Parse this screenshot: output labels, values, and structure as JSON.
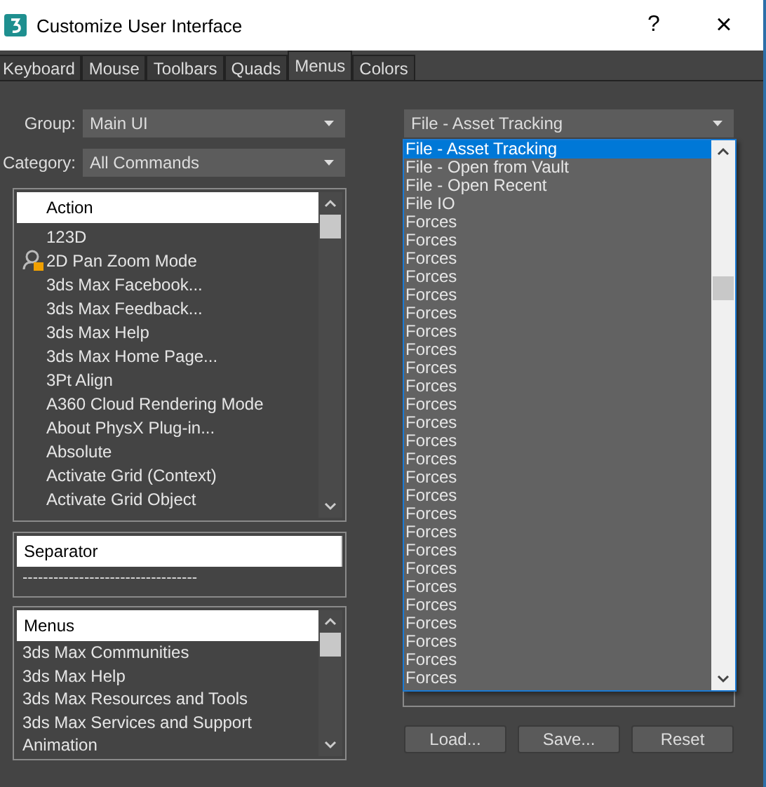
{
  "window": {
    "title": "Customize User Interface",
    "help": "?",
    "close": "×"
  },
  "tabs": [
    {
      "label": "Keyboard",
      "selected": false
    },
    {
      "label": "Mouse",
      "selected": false
    },
    {
      "label": "Toolbars",
      "selected": false
    },
    {
      "label": "Quads",
      "selected": false
    },
    {
      "label": "Menus",
      "selected": true
    },
    {
      "label": "Colors",
      "selected": false
    }
  ],
  "group": {
    "label": "Group:",
    "value": "Main UI"
  },
  "category": {
    "label": "Category:",
    "value": "All Commands"
  },
  "action_list": {
    "header": "Action",
    "items": [
      {
        "label": "123D",
        "kind": "plain"
      },
      {
        "label": "2D Pan Zoom Mode",
        "kind": "locked"
      },
      {
        "label": "3ds Max Facebook...",
        "kind": "plain"
      },
      {
        "label": "3ds Max Feedback...",
        "kind": "plain"
      },
      {
        "label": "3ds Max Help",
        "kind": "plain"
      },
      {
        "label": "3ds Max Home Page...",
        "kind": "plain"
      },
      {
        "label": "3Pt Align",
        "kind": "plain"
      },
      {
        "label": "A360 Cloud Rendering Mode",
        "kind": "plain"
      },
      {
        "label": "About PhysX Plug-in...",
        "kind": "plain"
      },
      {
        "label": "Absolute",
        "kind": "plain"
      },
      {
        "label": "Activate Grid (Context)",
        "kind": "plain"
      },
      {
        "label": "Activate Grid Object",
        "kind": "plain"
      }
    ]
  },
  "separator_list": {
    "header": "Separator",
    "items": [
      "----------------------------------"
    ]
  },
  "menus_list": {
    "header": "Menus",
    "items": [
      "3ds Max Communities",
      "3ds Max Help",
      "3ds Max Resources and Tools",
      "3ds Max Services and Support",
      "Animation"
    ]
  },
  "menu_dropdown": {
    "value": "File - Asset Tracking",
    "options": [
      {
        "label": "File - Asset Tracking",
        "selected": true
      },
      {
        "label": "File - Open from Vault",
        "selected": false
      },
      {
        "label": "File - Open Recent",
        "selected": false
      },
      {
        "label": "File IO",
        "selected": false
      },
      {
        "label": "Forces",
        "selected": false
      },
      {
        "label": "Forces",
        "selected": false
      },
      {
        "label": "Forces",
        "selected": false
      },
      {
        "label": "Forces",
        "selected": false
      },
      {
        "label": "Forces",
        "selected": false
      },
      {
        "label": "Forces",
        "selected": false
      },
      {
        "label": "Forces",
        "selected": false
      },
      {
        "label": "Forces",
        "selected": false
      },
      {
        "label": "Forces",
        "selected": false
      },
      {
        "label": "Forces",
        "selected": false
      },
      {
        "label": "Forces",
        "selected": false
      },
      {
        "label": "Forces",
        "selected": false
      },
      {
        "label": "Forces",
        "selected": false
      },
      {
        "label": "Forces",
        "selected": false
      },
      {
        "label": "Forces",
        "selected": false
      },
      {
        "label": "Forces",
        "selected": false
      },
      {
        "label": "Forces",
        "selected": false
      },
      {
        "label": "Forces",
        "selected": false
      },
      {
        "label": "Forces",
        "selected": false
      },
      {
        "label": "Forces",
        "selected": false
      },
      {
        "label": "Forces",
        "selected": false
      },
      {
        "label": "Forces",
        "selected": false
      },
      {
        "label": "Forces",
        "selected": false
      },
      {
        "label": "Forces",
        "selected": false
      },
      {
        "label": "Forces",
        "selected": false
      },
      {
        "label": "Forces",
        "selected": false
      }
    ]
  },
  "buttons": [
    "Load...",
    "Save...",
    "Reset"
  ]
}
